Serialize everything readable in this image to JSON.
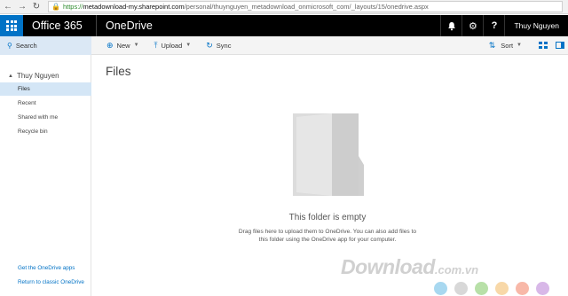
{
  "browser": {
    "url_scheme": "https://",
    "url_domain": "metadownload-my.sharepoint.com",
    "url_path": "/personal/thuynguyen_metadownload_onmicrosoft_com/_layouts/15/onedrive.aspx"
  },
  "suite": {
    "brand": "Office 365",
    "app_name": "OneDrive",
    "user_name": "Thuy Nguyen",
    "icons": [
      "bell-icon",
      "gear-icon",
      "help-icon"
    ],
    "accent_color": "#0072c6"
  },
  "command_bar": {
    "search_label": "Search",
    "new_label": "New",
    "upload_label": "Upload",
    "sync_label": "Sync",
    "sort_label": "Sort"
  },
  "left_nav": {
    "owner": "Thuy Nguyen",
    "items": [
      {
        "label": "Files",
        "active": true
      },
      {
        "label": "Recent",
        "active": false
      },
      {
        "label": "Shared with me",
        "active": false
      },
      {
        "label": "Recycle bin",
        "active": false
      }
    ],
    "footer_get_apps": "Get the OneDrive apps",
    "footer_return": "Return to classic OneDrive"
  },
  "main": {
    "title": "Files",
    "empty_title": "This folder is empty",
    "empty_description": "Drag files here to upload them to OneDrive. You can also add files to this folder using the OneDrive app for your computer."
  },
  "watermark": {
    "text": "Download",
    "suffix": ".com.vn",
    "dot_colors": [
      "#a8d8f0",
      "#d8d8d8",
      "#b8e0a8",
      "#f8d8a8",
      "#f8b8a8",
      "#d8b8e8"
    ]
  }
}
